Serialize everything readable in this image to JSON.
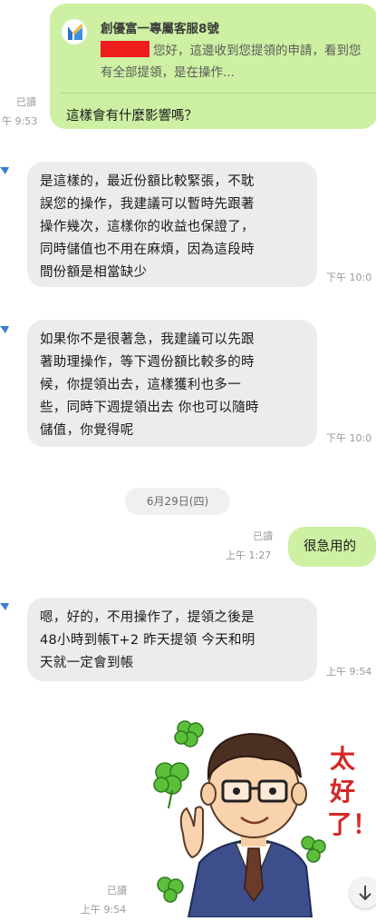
{
  "reply": {
    "sender": "創優富一專屬客服8號",
    "quoted_text": "您好，這邊收到您提領的申請，看到您有全部提領，是在操作...",
    "message": "這樣會有什麼影響嗎？",
    "read": "已讀",
    "time": "午 9:53"
  },
  "messages": [
    {
      "text": "是這樣的，最近份額比較緊張，不耽\n誤您的操作，我建議可以暫時先跟著\n操作幾次，這樣你的收益也保證了，\n同時儲值也不用在麻煩，因為這段時\n間份額是相當缺少",
      "time": "下午 10:0"
    },
    {
      "text": "如果你不是很著急，我建議可以先跟\n著助理操作，等下週份額比較多的時\n候，你提領出去，這樣獲利也多一\n些，同時下週提領出去 你也可以隨時\n儲值，你覺得呢",
      "time": "下午 10:0"
    },
    {
      "text": "嗯，好的，不用操作了，提領之後是\n48小時到帳T+2  昨天提領  今天和明\n天就一定會到帳",
      "time": "上午 9:54"
    }
  ],
  "date_divider": "6月29日(四)",
  "my_message": {
    "text": "很急用的",
    "read": "已讀",
    "time": "上午 1:27"
  },
  "sticker": {
    "text": "太好了！",
    "read": "已讀",
    "time": "上午 9:54"
  },
  "scroll_down_icon": "arrow-down-icon"
}
